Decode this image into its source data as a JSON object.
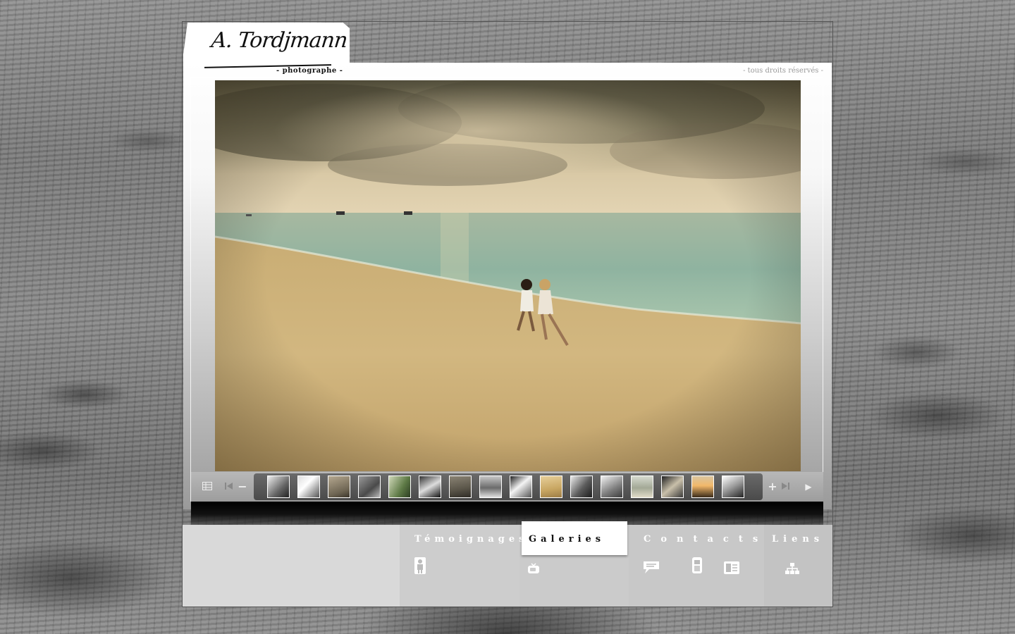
{
  "header": {
    "signature": "A. Tordjmann",
    "tagline": "- photographe -",
    "rights": "- tous droits réservés -"
  },
  "photo": {
    "subject": "two girls running on beach at sunset"
  },
  "filmstrip": {
    "thumbnail_count": 16,
    "controls": {
      "grid": "grid-view-icon",
      "first": "first-icon",
      "zoom_out": "−",
      "zoom_in": "+",
      "last": "last-icon",
      "play": "▶"
    }
  },
  "nav": {
    "temoignages": "Témoignages",
    "galeries": "Galeries",
    "contacts": "Contacts",
    "liens": "Liens"
  },
  "colors": {
    "nav_active_bg": "#ffffff",
    "nav_panel": "#d9d9d9"
  }
}
